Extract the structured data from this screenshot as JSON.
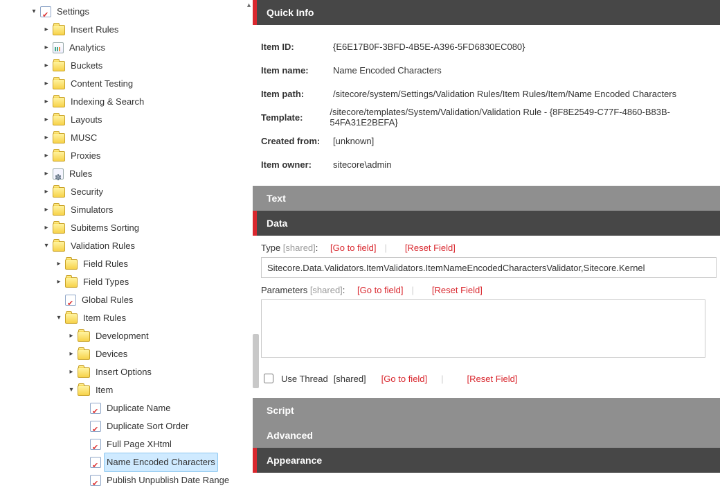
{
  "tree": {
    "settings": "Settings",
    "items": [
      "Insert Rules",
      "Analytics",
      "Buckets",
      "Content Testing",
      "Indexing & Search",
      "Layouts",
      "MUSC",
      "Proxies",
      "Rules",
      "Security",
      "Simulators",
      "Subitems Sorting"
    ],
    "validation_rules": "Validation Rules",
    "field_rules": "Field Rules",
    "field_types": "Field Types",
    "global_rules": "Global Rules",
    "item_rules": "Item Rules",
    "ir_children": [
      "Development",
      "Devices",
      "Insert Options"
    ],
    "item": "Item",
    "item_children": [
      "Duplicate Name",
      "Duplicate Sort Order",
      "Full Page XHtml",
      "Name Encoded Characters",
      "Publish Unpublish Date Range"
    ]
  },
  "sections": {
    "quick_info": "Quick Info",
    "text": "Text",
    "data": "Data",
    "script": "Script",
    "advanced": "Advanced",
    "appearance": "Appearance"
  },
  "quickinfo": {
    "k_id": "Item ID:",
    "v_id": "{E6E17B0F-3BFD-4B5E-A396-5FD6830EC080}",
    "k_name": "Item name:",
    "v_name": "Name Encoded Characters",
    "k_path": "Item path:",
    "v_path": "/sitecore/system/Settings/Validation Rules/Item Rules/Item/Name Encoded Characters",
    "k_tpl": "Template:",
    "v_tpl": "/sitecore/templates/System/Validation/Validation Rule - {8F8E2549-C77F-4860-B83B-54FA31E2BEFA}",
    "k_from": "Created from:",
    "v_from": "[unknown]",
    "k_owner": "Item owner:",
    "v_owner": "sitecore\\admin"
  },
  "data": {
    "type_label": "Type",
    "params_label": "Parameters",
    "usethread_label": "Use Thread",
    "shared": " [shared]",
    "go": "[Go to field]",
    "reset": "[Reset Field]",
    "type_value": "Sitecore.Data.Validators.ItemValidators.ItemNameEncodedCharactersValidator,Sitecore.Kernel",
    "params_value": ""
  }
}
